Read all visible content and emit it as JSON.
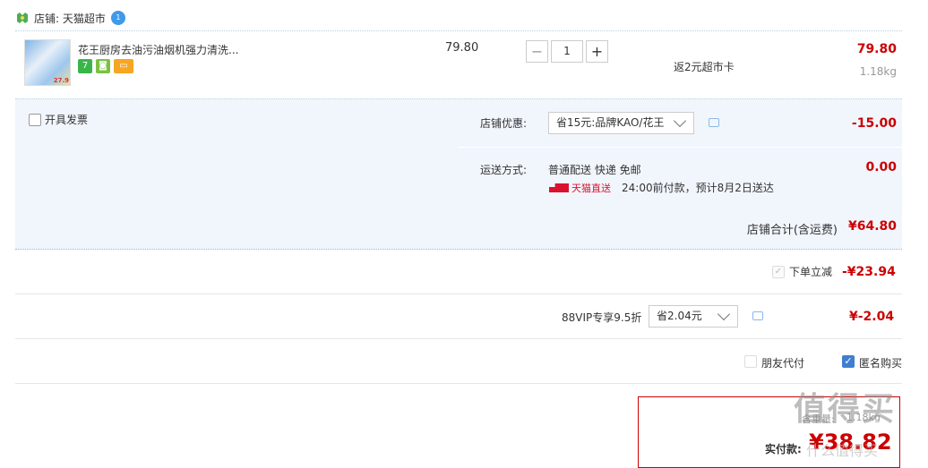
{
  "shop": {
    "label": "店铺: 天猫超市",
    "wangwang_badge": "1"
  },
  "item": {
    "title": "花王厨房去油污油烟机强力清洗...",
    "thumb_tag": "27.9",
    "badge_7": "7",
    "unit_price": "79.80",
    "quantity": "1",
    "minus": "−",
    "plus": "+",
    "gift": "返2元超市卡",
    "sum": "79.80",
    "weight": "1.18kg"
  },
  "options": {
    "invoice_label": "开具发票",
    "discount_label": "店铺优惠:",
    "discount_value": "省15元:品牌KAO/花王",
    "discount_amount": "-15.00",
    "delivery_label": "运送方式:",
    "delivery_value": "普通配送 快递 免邮",
    "tmall_direct": "天猫直送",
    "delivery_note": "24:00前付款，预计8月2日送达",
    "delivery_amount": "0.00"
  },
  "shop_total": {
    "label": "店铺合计(含运费)",
    "value": "¥64.80"
  },
  "instant_discount": {
    "label": "下单立减",
    "value": "-¥23.94"
  },
  "vip": {
    "label": "88VIP专享9.5折",
    "select_value": "省2.04元",
    "value": "¥-2.04"
  },
  "checkout_opts": {
    "friend_pay": "朋友代付",
    "anonymous": "匿名购买"
  },
  "payment": {
    "weight_label": "含重量:",
    "weight_value": "1.18kg",
    "label": "实付款:",
    "value": "¥38.82"
  },
  "watermark": {
    "main": "值得买",
    "sub": "什么值得买"
  },
  "colors": {
    "accent_red": "#cc0000",
    "panel_blue": "#f1f6fd",
    "check_blue": "#3f7ed1"
  }
}
